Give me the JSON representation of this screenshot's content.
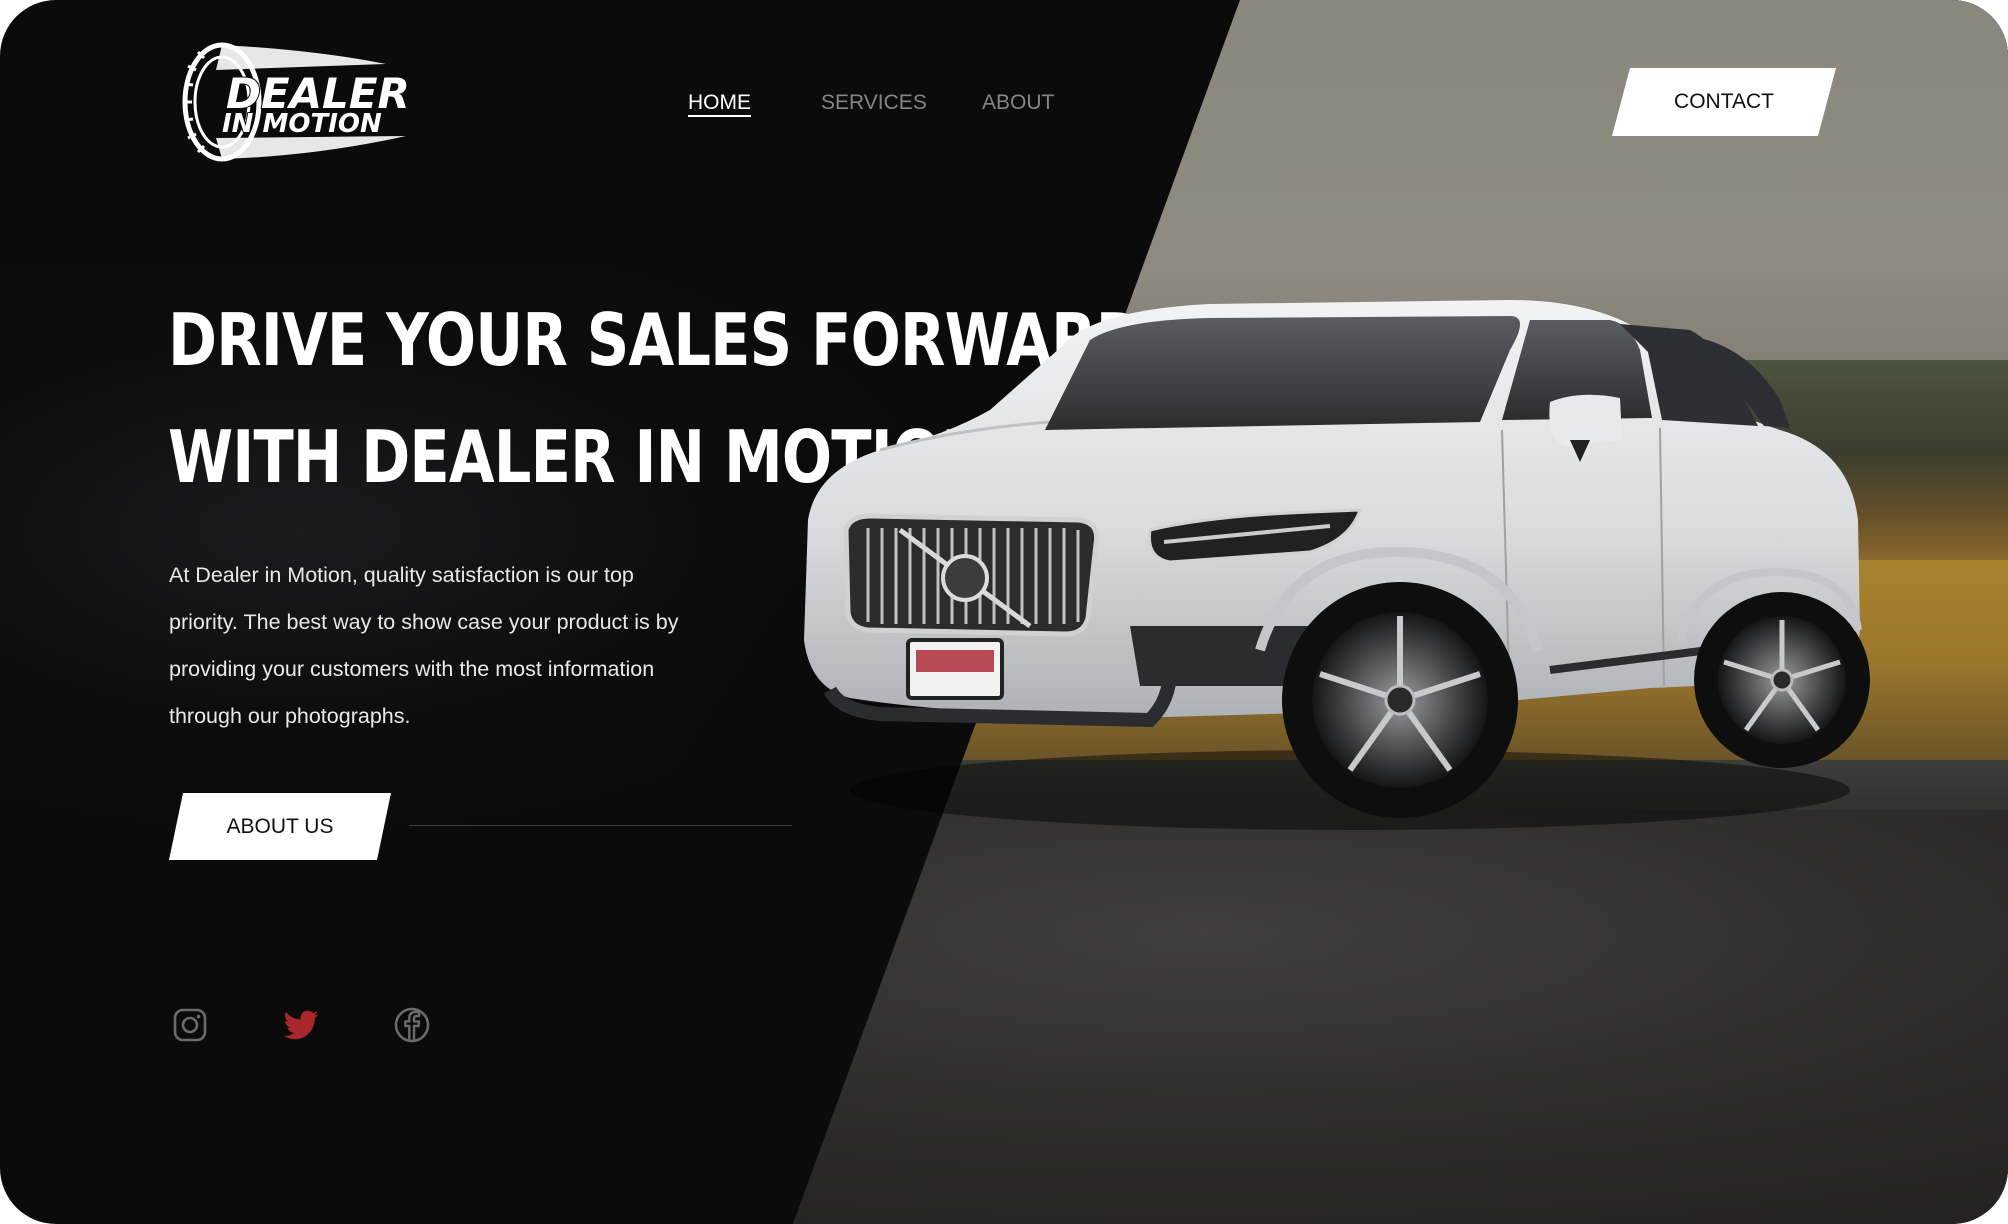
{
  "brand": {
    "line1": "DEALER",
    "line2": "IN MOTION"
  },
  "nav": {
    "items": [
      {
        "label": "HOME",
        "active": true
      },
      {
        "label": "SERVICES",
        "active": false
      },
      {
        "label": "ABOUT",
        "active": false
      }
    ],
    "contact_label": "CONTACT"
  },
  "hero": {
    "headline_line1": "DRIVE YOUR SALES FORWARD",
    "headline_line2": "WITH DEALER IN MOTION",
    "body_lines": [
      "At Dealer in Motion, quality satisfaction is our top",
      "priority. The best way to show case your product is by",
      "providing your customers with the most information",
      "through our photographs."
    ],
    "cta_label": "ABOUT US"
  },
  "social": {
    "icons": [
      "instagram-icon",
      "twitter-icon",
      "facebook-icon"
    ],
    "twitter_color": "#a8262e",
    "muted_color": "#6b6b6b"
  },
  "colors": {
    "background": "#0b0b0b",
    "accent": "#ffffff"
  }
}
